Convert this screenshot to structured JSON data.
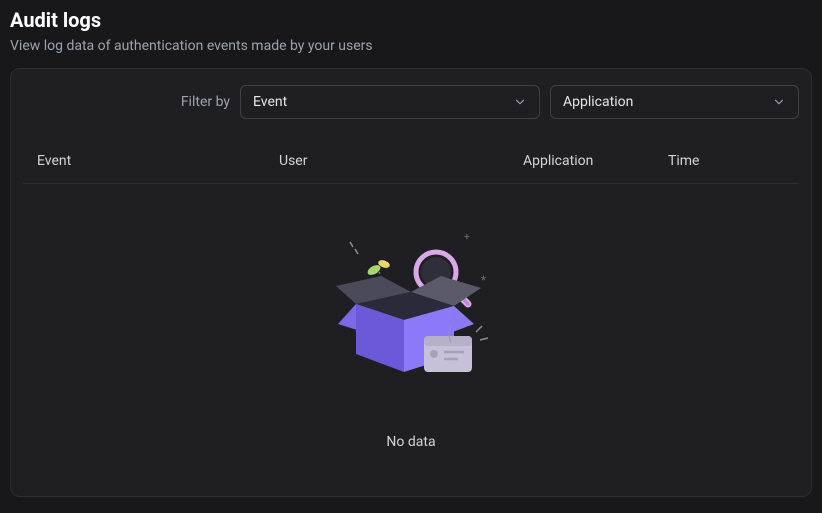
{
  "header": {
    "title": "Audit logs",
    "subtitle": "View log data of authentication events made by your users"
  },
  "filters": {
    "label": "Filter by",
    "event_select": "Event",
    "application_select": "Application"
  },
  "table": {
    "columns": {
      "event": "Event",
      "user": "User",
      "application": "Application",
      "time": "Time"
    }
  },
  "empty_state": {
    "message": "No data"
  }
}
